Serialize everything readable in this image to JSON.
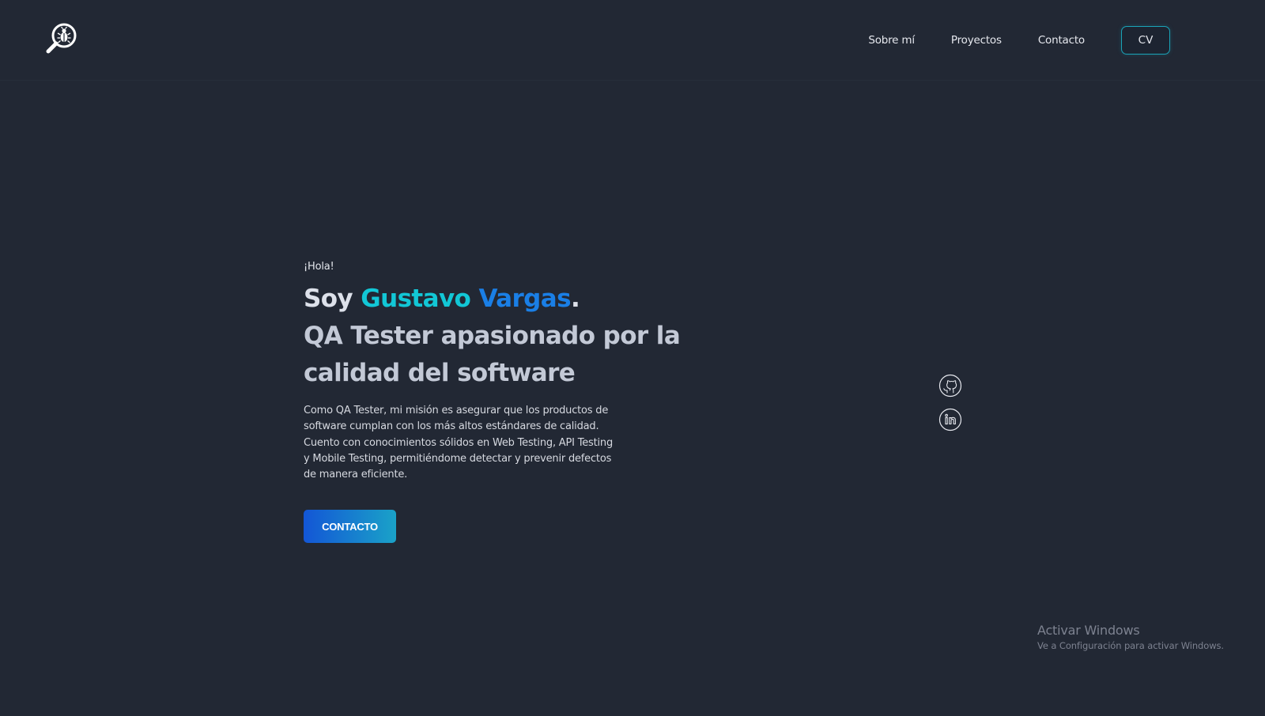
{
  "header": {
    "logo_icon": "magnifier-bug-icon",
    "nav": [
      {
        "label": "Sobre mí"
      },
      {
        "label": "Proyectos"
      },
      {
        "label": "Contacto"
      }
    ],
    "cv_label": "CV"
  },
  "hero": {
    "greeting": "¡Hola!",
    "headline": {
      "soy": "Soy",
      "first_name": "Gustavo",
      "last_name": "Vargas",
      "dot": ".",
      "tagline": "QA Tester apasionado por la calidad del software"
    },
    "description": "Como QA Tester, mi misión es asegurar que los productos de software cumplan con los más altos estándares de calidad. Cuento con conocimientos sólidos en Web Testing, API Testing y Mobile Testing, permitiéndome detectar y prevenir defectos de manera eficiente.",
    "cta_label": "CONTACTO"
  },
  "social": [
    {
      "icon": "github-icon"
    },
    {
      "icon": "linkedin-icon"
    }
  ],
  "windows_watermark": {
    "title": "Activar Windows",
    "subtitle": "Ve a Configuración para activar Windows."
  },
  "colors": {
    "background": "#222834",
    "accent_cyan": "#12c7d6",
    "accent_blue": "#1a7fe6",
    "button_start": "#1356d6",
    "button_end": "#1aa2c8"
  }
}
